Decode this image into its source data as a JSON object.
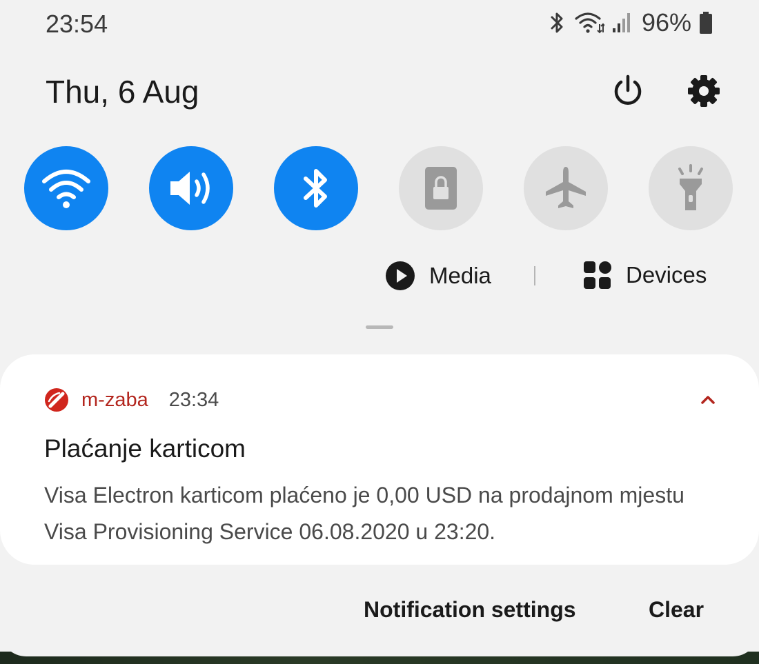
{
  "status_bar": {
    "time": "23:54",
    "battery": "96%",
    "icons": [
      "bluetooth-icon",
      "wifi-icon",
      "signal-icon",
      "battery-icon"
    ]
  },
  "header": {
    "date": "Thu, 6 Aug",
    "icons": [
      "power-icon",
      "gear-icon"
    ]
  },
  "quick_toggles": [
    {
      "icon": "wifi-icon",
      "state": "on"
    },
    {
      "icon": "sound-icon",
      "state": "on"
    },
    {
      "icon": "bluetooth-icon",
      "state": "on"
    },
    {
      "icon": "screen-lock-icon",
      "state": "off"
    },
    {
      "icon": "airplane-icon",
      "state": "off"
    },
    {
      "icon": "flashlight-icon",
      "state": "off"
    }
  ],
  "media_row": {
    "media_label": "Media",
    "devices_label": "Devices"
  },
  "notification": {
    "app_name": "m-zaba",
    "time": "23:34",
    "title": "Plaćanje karticom",
    "body": "Visa Electron karticom plaćeno je 0,00 USD na prodajnom mjestu Visa Provisioning Service 06.08.2020 u 23:20."
  },
  "actions": {
    "settings_label": "Notification settings",
    "clear_label": "Clear"
  },
  "colors": {
    "toggle_on": "#0f84f1",
    "toggle_off": "#e0e0e0",
    "app_accent": "#b3261e",
    "panel_bg": "#f2f2f2"
  }
}
